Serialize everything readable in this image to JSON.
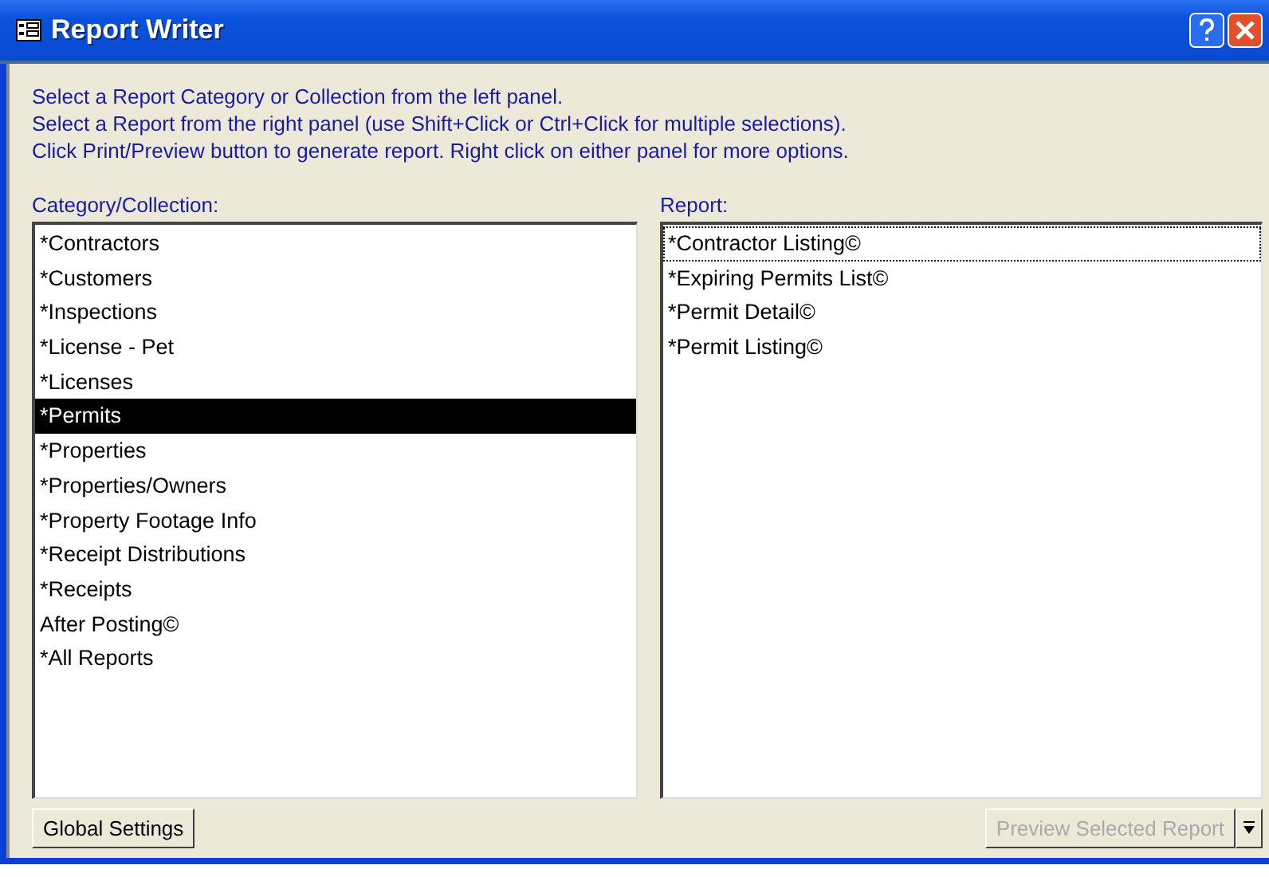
{
  "window": {
    "title": "Report Writer"
  },
  "instructions": [
    "Select a Report Category or Collection from the left panel.",
    "Select a Report from the right panel (use Shift+Click or Ctrl+Click for multiple selections).",
    "Click Print/Preview button to generate report. Right click on either panel for more options."
  ],
  "category_panel": {
    "label": "Category/Collection:",
    "items": [
      {
        "text": "*Contractors",
        "selected": false
      },
      {
        "text": "*Customers",
        "selected": false
      },
      {
        "text": "*Inspections",
        "selected": false
      },
      {
        "text": "*License - Pet",
        "selected": false
      },
      {
        "text": "*Licenses",
        "selected": false
      },
      {
        "text": "*Permits",
        "selected": true
      },
      {
        "text": "*Properties",
        "selected": false
      },
      {
        "text": "*Properties/Owners",
        "selected": false
      },
      {
        "text": "*Property Footage Info",
        "selected": false
      },
      {
        "text": "*Receipt Distributions",
        "selected": false
      },
      {
        "text": "*Receipts",
        "selected": false
      },
      {
        "text": "After Posting©",
        "selected": false
      },
      {
        "text": "*All Reports",
        "selected": false
      }
    ]
  },
  "report_panel": {
    "label": "Report:",
    "items": [
      {
        "text": "*Contractor Listing©",
        "selected": false,
        "focused": true
      },
      {
        "text": "*Expiring Permits List©",
        "selected": false,
        "focused": false
      },
      {
        "text": "*Permit Detail©",
        "selected": false,
        "focused": false
      },
      {
        "text": "*Permit Listing©",
        "selected": false,
        "focused": false
      }
    ]
  },
  "buttons": {
    "global_settings": {
      "label": "Global Settings",
      "disabled": false
    },
    "preview": {
      "label": "Preview Selected Report",
      "disabled": true
    }
  }
}
